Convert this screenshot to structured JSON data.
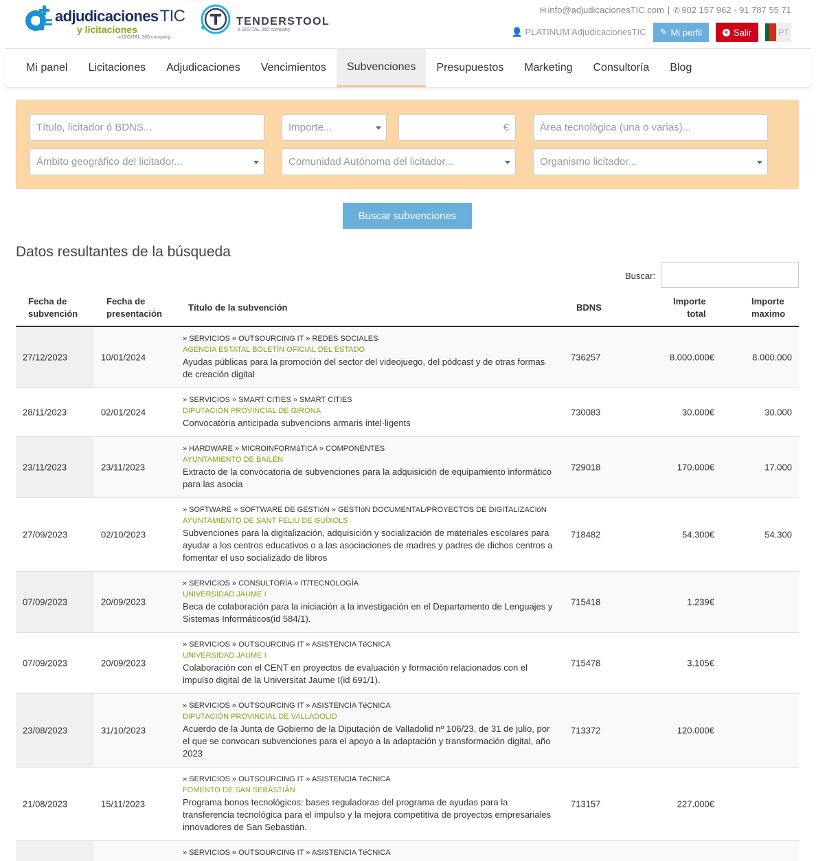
{
  "header": {
    "logo_adj": {
      "main": "adjudicaciones",
      "tic": "TIC",
      "sub": "y licitaciones",
      "tag": "a DIGITAL 360 company"
    },
    "logo_tt": {
      "name": "TENDERSTOOL",
      "tag": "a DIGITAL 360 company"
    },
    "email": "info@adjudicacionesTIC.com",
    "phone": "902 157 962 · 91 787 55 71",
    "username": "PLATINUM AdjudicacionesTIC",
    "profile_label": "Mi perfil",
    "exit_label": "Salir",
    "lang": "PT"
  },
  "nav": {
    "items": [
      "Mi panel",
      "Licitaciones",
      "Adjudicaciones",
      "Vencimientos",
      "Subvenciones",
      "Presupuestos",
      "Marketing",
      "Consultoría",
      "Blog"
    ],
    "active": "Subvenciones"
  },
  "filters": {
    "title_placeholder": "Título, licitador ó BDNS...",
    "amount_placeholder": "Importe...",
    "euro": "€",
    "tech_area_placeholder": "Área tecnológica (una o varias)...",
    "geo_placeholder": "Ámbito geográfico del licitador...",
    "region_placeholder": "Comunidad Autónoma del licitador...",
    "org_placeholder": "Organismo licitador..."
  },
  "search_button": "Buscar subvenciones",
  "results": {
    "title": "Datos resultantes de la búsqueda",
    "search_label": "Buscar:",
    "columns": {
      "date_l1": "Fecha de",
      "date_l2": "subvención",
      "pres_l1": "Fecha de",
      "pres_l2": "presentación",
      "title": "Título de la subvención",
      "bdns": "BDNS",
      "total_l1": "Importe",
      "total_l2": "total",
      "max_l1": "Importe",
      "max_l2": "maximo"
    },
    "rows": [
      {
        "date": "27/12/2023",
        "pres": "10/01/2024",
        "cat": "» SERVICIOS » OUTSOURCING IT » REDES SOCIALES",
        "org": "AGENCIA ESTATAL BOLETÍN OFICIAL DEL ESTADO",
        "desc": "Ayudas públicas para la promoción del sector del videojuego, del pódcast y de otras formas de creación digital",
        "bdns": "736257",
        "total": "8.000.000€",
        "max": "8.000.000"
      },
      {
        "date": "28/11/2023",
        "pres": "02/01/2024",
        "cat": "» SERVICIOS » SMART CITIES » SMART CITIES",
        "org": "DIPUTACIÓN PROVINCIAL DE GIRONA",
        "desc": "Convocatòria anticipada subvencions armaris intel·ligents",
        "bdns": "730083",
        "total": "30.000€",
        "max": "30.000"
      },
      {
        "date": "23/11/2023",
        "pres": "23/11/2023",
        "cat": "» HARDWARE » MICROINFORMáTICA » COMPONENTES",
        "org": "AYUNTAMIENTO DE BAILÉN",
        "desc": "Extracto de la convocatoria de subvenciones para la adquisición de equipamiento informático para las asocia",
        "bdns": "729018",
        "total": "170.000€",
        "max": "17.000"
      },
      {
        "date": "27/09/2023",
        "pres": "02/10/2023",
        "cat": "» SOFTWARE » SOFTWARE DE GESTIóN » GESTIóN DOCUMENTAL/PROYECTOS DE DIGITALIZACIóN",
        "org": "AYUNTAMIENTO DE SANT FELIU DE GUÍXOLS",
        "desc": "Subvenciones para la digitalización, adquisición y socialización de materiales escolares para ayudar a los centros educativos o a las asociaciones de madres y padres de dichos centros a fomentar el uso socializado de libros",
        "bdns": "718482",
        "total": "54.300€",
        "max": "54.300"
      },
      {
        "date": "07/09/2023",
        "pres": "20/09/2023",
        "cat": "» SERVICIOS » CONSULTORÍA » IT/TECNOLOGÍA",
        "org": "UNIVERSIDAD JAUME I",
        "desc": "Beca de colaboración para la iniciación a la investigación en el Departamento de Lenguajes y Sistemas Informáticos(id 584/1).",
        "bdns": "715418",
        "total": "1.239€",
        "max": ""
      },
      {
        "date": "07/09/2023",
        "pres": "20/09/2023",
        "cat": "» SERVICIOS » OUTSOURCING IT » ASISTENCIA TéCNICA",
        "org": "UNIVERSIDAD JAUME I",
        "desc": "Colaboración con el CENT en proyectos de evaluación y formación relacionados con el impulso digital de la Universitat Jaume I(id 691/1).",
        "bdns": "715478",
        "total": "3.105€",
        "max": ""
      },
      {
        "date": "23/08/2023",
        "pres": "31/10/2023",
        "cat": "» SERVICIOS » OUTSOURCING IT » ASISTENCIA TéCNICA",
        "org": "DIPUTACIÓN PROVINCIAL DE VALLADOLID",
        "desc": "Acuerdo de la Junta de Gobierno de la Diputación de Valladolid nº 106/23, de 31 de julio, por el que se convocan subvenciones para el apoyo a la adaptación y transformación digital, año 2023",
        "bdns": "713372",
        "total": "120.000€",
        "max": ""
      },
      {
        "date": "21/08/2023",
        "pres": "15/11/2023",
        "cat": "» SERVICIOS » OUTSOURCING IT » ASISTENCIA TéCNICA",
        "org": "FOMENTO DE SAN SEBASTIÁN",
        "desc": "Programa bonos tecnológicos: bases reguladoras del programa de ayudas para la transferencia tecnológica para el impulso y la mejora competitiva de proyectos empresariales innovadores de San Sebastián.",
        "bdns": "713157",
        "total": "227.000€",
        "max": ""
      },
      {
        "date": "",
        "pres": "",
        "cat": "» SERVICIOS » OUTSOURCING IT » ASISTENCIA TéCNICA",
        "org": "",
        "desc": "",
        "bdns": "",
        "total": "",
        "max": ""
      }
    ]
  },
  "colors": {
    "accent": "#6aaedc",
    "danger": "#d0021b",
    "filter_bg": "#fdd6a6",
    "org_green": "#8aa51b"
  }
}
